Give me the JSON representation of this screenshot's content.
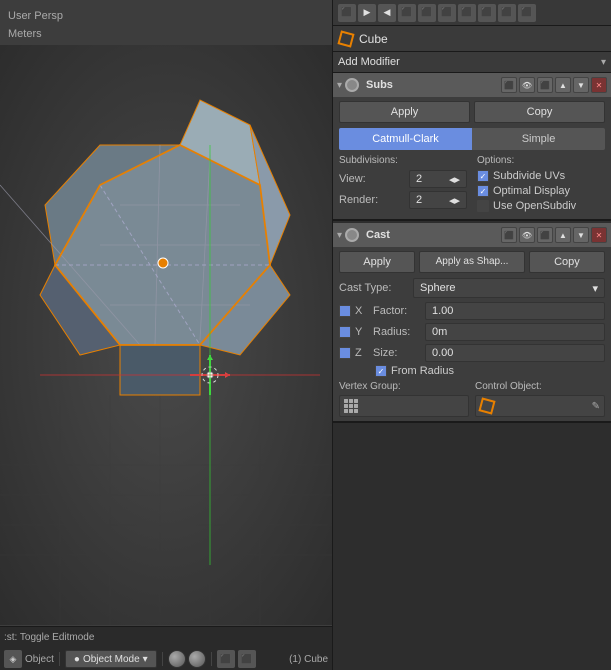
{
  "viewport": {
    "info_line1": "User Persp",
    "info_line2": "Meters"
  },
  "header_icons": [
    "⬛",
    "▶",
    "◀",
    "⬛",
    "⬛",
    "⬛",
    "⬛",
    "⬛",
    "⬛",
    "⬛"
  ],
  "object": {
    "name": "Cube"
  },
  "add_modifier": {
    "label": "Add Modifier",
    "dropdown_char": "▾"
  },
  "modifier_subs": {
    "name": "Subs",
    "apply_label": "Apply",
    "copy_label": "Copy",
    "tab_catmull": "Catmull-Clark",
    "tab_simple": "Simple",
    "subdivisions_label": "Subdivisions:",
    "options_label": "Options:",
    "view_label": "View:",
    "view_value": "2",
    "render_label": "Render:",
    "render_value": "2",
    "subdivide_uvs_label": "Subdivide UVs",
    "subdivide_uvs_checked": true,
    "optimal_display_label": "Optimal Display",
    "optimal_display_checked": true,
    "use_opensubdiv_label": "Use OpenSubdiv",
    "use_opensubdiv_checked": false
  },
  "modifier_cast": {
    "name": "Cast",
    "apply_label": "Apply",
    "apply_shape_label": "Apply as Shap...",
    "copy_label": "Copy",
    "cast_type_label": "Cast Type:",
    "cast_type_value": "Sphere",
    "x_label": "X",
    "x_checked": true,
    "factor_label": "Factor:",
    "factor_value": "1.00",
    "y_label": "Y",
    "y_checked": true,
    "radius_label": "Radius:",
    "radius_value": "0m",
    "z_label": "Z",
    "z_checked": true,
    "size_label": "Size:",
    "size_value": "0.00",
    "from_radius_label": "From Radius",
    "from_radius_checked": true,
    "vertex_group_label": "Vertex Group:",
    "control_object_label": "Control Object:"
  },
  "bottom_bar": {
    "toggle_text": ":st: Toggle Editmode",
    "cube_label": "(1) Cube"
  },
  "viewport_toolbar": {
    "object_mode_label": "Object Mode",
    "object_tab_label": "Object"
  }
}
